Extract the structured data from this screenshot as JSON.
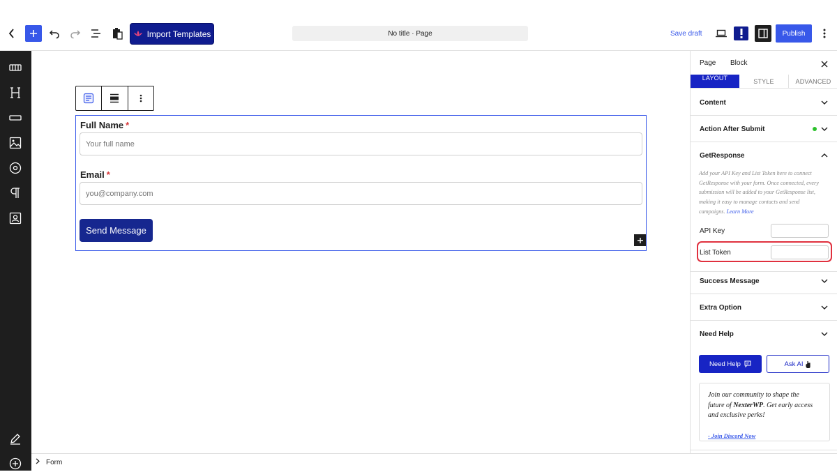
{
  "topbar": {
    "import_label": "Import Templates",
    "doc_title": "No title · Page",
    "save_draft": "Save draft",
    "publish": "Publish",
    "accent": "#3858e9"
  },
  "form": {
    "full_name_label": "Full Name",
    "full_name_placeholder": "Your full name",
    "email_label": "Email",
    "email_placeholder": "you@company.com",
    "required_mark": "*",
    "submit_label": "Send Message"
  },
  "panel": {
    "tab_page": "Page",
    "tab_block": "Block",
    "subtabs": [
      "LAYOUT",
      "STYLE",
      "ADVANCED"
    ],
    "sections": {
      "content": "Content",
      "action_after_submit": "Action After Submit",
      "getresponse": "GetResponse",
      "success_message": "Success Message",
      "extra_option": "Extra Option",
      "need_help": "Need Help"
    },
    "gr_desc_lines": [
      "Add your API Key and List Token here to connect",
      "GetResponse with your form. Once connected, every",
      "submission will be added to your GetResponse list,",
      "making it easy to manage contacts and send"
    ],
    "gr_desc_last": "campaigns.",
    "learn_more": "Learn More",
    "api_key_label": "API Key",
    "list_token_label": "List Token",
    "need_help_btn": "Need Help",
    "ask_ai_btn": "Ask AI",
    "community": {
      "line1": "Join our community to shape the",
      "line2_pre": "future of ",
      "brand": "NexterWP",
      "line2_post": ". Get early access",
      "line3": "and exclusive perks!",
      "discord": "- Join Discord Now"
    }
  },
  "footer": {
    "breadcrumb": "Form"
  }
}
